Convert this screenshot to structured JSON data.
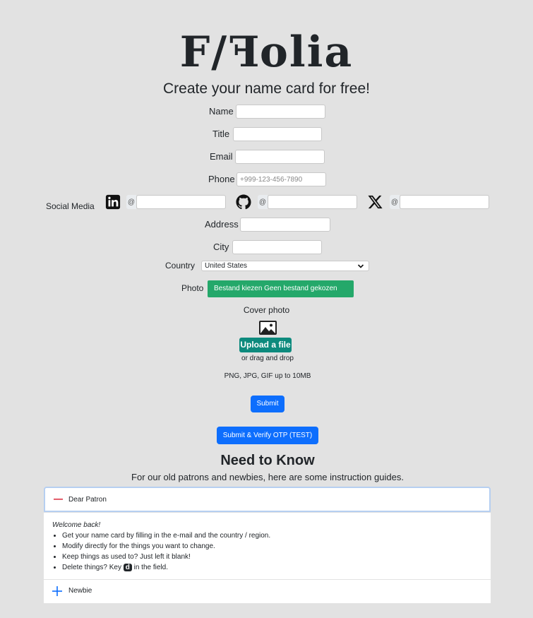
{
  "header": {
    "logo_left": "F/",
    "logo_flipped": "F",
    "logo_right": "olia",
    "subtitle": "Create your name card for free!"
  },
  "form": {
    "name_label": "Name",
    "title_label": "Title",
    "email_label": "Email",
    "phone_label": "Phone",
    "phone_placeholder": "+999-123-456-7890",
    "social_label": "Social Media",
    "social_prefix": "@",
    "social_icons": [
      "linkedin-icon",
      "github-icon",
      "x-icon"
    ],
    "address_label": "Address",
    "city_label": "City",
    "country_label": "Country",
    "country_value": "United States",
    "photo_label": "Photo",
    "photo_button": "Bestand kiezen Geen bestand gekozen",
    "cover_label": "Cover photo",
    "upload_label": "Upload a file",
    "drag_text": "or drag and drop",
    "file_types": "PNG, JPG, GIF up to 10MB",
    "submit_label": "Submit",
    "submit_otp_label": "Submit & Verify OTP (TEST)"
  },
  "guide": {
    "heading": "Need to Know",
    "intro": "For our old patrons and newbies, here are some instruction guides.",
    "sections": [
      {
        "title": "Dear Patron",
        "expanded": true,
        "welcome": "Welcome back!",
        "items": [
          "Get your name card by filling in the e-mail and the country / region.",
          "Modify directly for the things you want to change.",
          "Keep things as used to? Just left it blank!"
        ],
        "delete_pre": "Delete things? Key",
        "delete_key": "d",
        "delete_post": "in the field."
      },
      {
        "title": "Newbie",
        "expanded": false
      }
    ]
  },
  "colors": {
    "background": "#e2e2e2",
    "primary_button": "#0d6efd",
    "file_button": "#24a86a",
    "upload_button": "#0d8a7d",
    "collapse_icon": "#dc3545",
    "expand_icon": "#0d6efd"
  }
}
